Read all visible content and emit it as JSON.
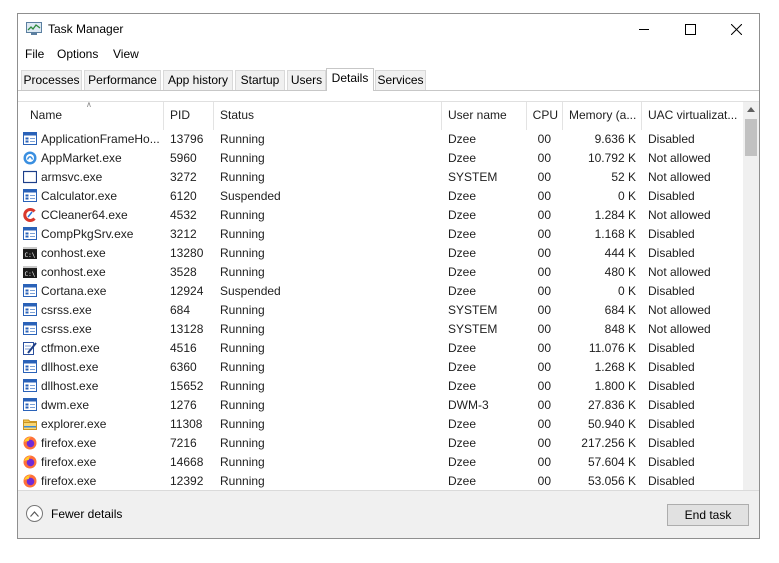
{
  "window": {
    "title": "Task Manager"
  },
  "menu": [
    "File",
    "Options",
    "View"
  ],
  "tabs": [
    {
      "label": "Processes"
    },
    {
      "label": "Performance"
    },
    {
      "label": "App history"
    },
    {
      "label": "Startup"
    },
    {
      "label": "Users"
    },
    {
      "label": "Details",
      "active": true
    },
    {
      "label": "Services"
    }
  ],
  "columns": [
    "Name",
    "PID",
    "Status",
    "User name",
    "CPU",
    "Memory (a...",
    "UAC virtualizat..."
  ],
  "rows": [
    {
      "icon": "app-window-icon",
      "name": "ApplicationFrameHo...",
      "pid": "13796",
      "status": "Running",
      "user": "Dzee",
      "cpu": "00",
      "memory": "9.636 K",
      "uac": "Disabled"
    },
    {
      "icon": "appmarket-icon",
      "name": "AppMarket.exe",
      "pid": "5960",
      "status": "Running",
      "user": "Dzee",
      "cpu": "00",
      "memory": "10.792 K",
      "uac": "Not allowed"
    },
    {
      "icon": "blank-window-icon",
      "name": "armsvc.exe",
      "pid": "3272",
      "status": "Running",
      "user": "SYSTEM",
      "cpu": "00",
      "memory": "52 K",
      "uac": "Not allowed"
    },
    {
      "icon": "app-window-icon",
      "name": "Calculator.exe",
      "pid": "6120",
      "status": "Suspended",
      "user": "Dzee",
      "cpu": "00",
      "memory": "0 K",
      "uac": "Disabled"
    },
    {
      "icon": "ccleaner-icon",
      "name": "CCleaner64.exe",
      "pid": "4532",
      "status": "Running",
      "user": "Dzee",
      "cpu": "00",
      "memory": "1.284 K",
      "uac": "Not allowed"
    },
    {
      "icon": "app-window-icon",
      "name": "CompPkgSrv.exe",
      "pid": "3212",
      "status": "Running",
      "user": "Dzee",
      "cpu": "00",
      "memory": "1.168 K",
      "uac": "Disabled"
    },
    {
      "icon": "console-icon",
      "name": "conhost.exe",
      "pid": "13280",
      "status": "Running",
      "user": "Dzee",
      "cpu": "00",
      "memory": "444 K",
      "uac": "Disabled"
    },
    {
      "icon": "console-icon",
      "name": "conhost.exe",
      "pid": "3528",
      "status": "Running",
      "user": "Dzee",
      "cpu": "00",
      "memory": "480 K",
      "uac": "Not allowed"
    },
    {
      "icon": "app-window-icon",
      "name": "Cortana.exe",
      "pid": "12924",
      "status": "Suspended",
      "user": "Dzee",
      "cpu": "00",
      "memory": "0 K",
      "uac": "Disabled"
    },
    {
      "icon": "app-window-icon",
      "name": "csrss.exe",
      "pid": "684",
      "status": "Running",
      "user": "SYSTEM",
      "cpu": "00",
      "memory": "684 K",
      "uac": "Not allowed"
    },
    {
      "icon": "app-window-icon",
      "name": "csrss.exe",
      "pid": "13128",
      "status": "Running",
      "user": "SYSTEM",
      "cpu": "00",
      "memory": "848 K",
      "uac": "Not allowed"
    },
    {
      "icon": "ctfmon-icon",
      "name": "ctfmon.exe",
      "pid": "4516",
      "status": "Running",
      "user": "Dzee",
      "cpu": "00",
      "memory": "11.076 K",
      "uac": "Disabled"
    },
    {
      "icon": "app-window-icon",
      "name": "dllhost.exe",
      "pid": "6360",
      "status": "Running",
      "user": "Dzee",
      "cpu": "00",
      "memory": "1.268 K",
      "uac": "Disabled"
    },
    {
      "icon": "app-window-icon",
      "name": "dllhost.exe",
      "pid": "15652",
      "status": "Running",
      "user": "Dzee",
      "cpu": "00",
      "memory": "1.800 K",
      "uac": "Disabled"
    },
    {
      "icon": "app-window-icon",
      "name": "dwm.exe",
      "pid": "1276",
      "status": "Running",
      "user": "DWM-3",
      "cpu": "00",
      "memory": "27.836 K",
      "uac": "Disabled"
    },
    {
      "icon": "folder-icon",
      "name": "explorer.exe",
      "pid": "11308",
      "status": "Running",
      "user": "Dzee",
      "cpu": "00",
      "memory": "50.940 K",
      "uac": "Disabled"
    },
    {
      "icon": "firefox-icon",
      "name": "firefox.exe",
      "pid": "7216",
      "status": "Running",
      "user": "Dzee",
      "cpu": "00",
      "memory": "217.256 K",
      "uac": "Disabled"
    },
    {
      "icon": "firefox-icon",
      "name": "firefox.exe",
      "pid": "14668",
      "status": "Running",
      "user": "Dzee",
      "cpu": "00",
      "memory": "57.604 K",
      "uac": "Disabled"
    },
    {
      "icon": "firefox-icon",
      "name": "firefox.exe",
      "pid": "12392",
      "status": "Running",
      "user": "Dzee",
      "cpu": "00",
      "memory": "53.056 K",
      "uac": "Disabled"
    }
  ],
  "footer": {
    "fewer_details": "Fewer details",
    "end_task": "End task"
  }
}
